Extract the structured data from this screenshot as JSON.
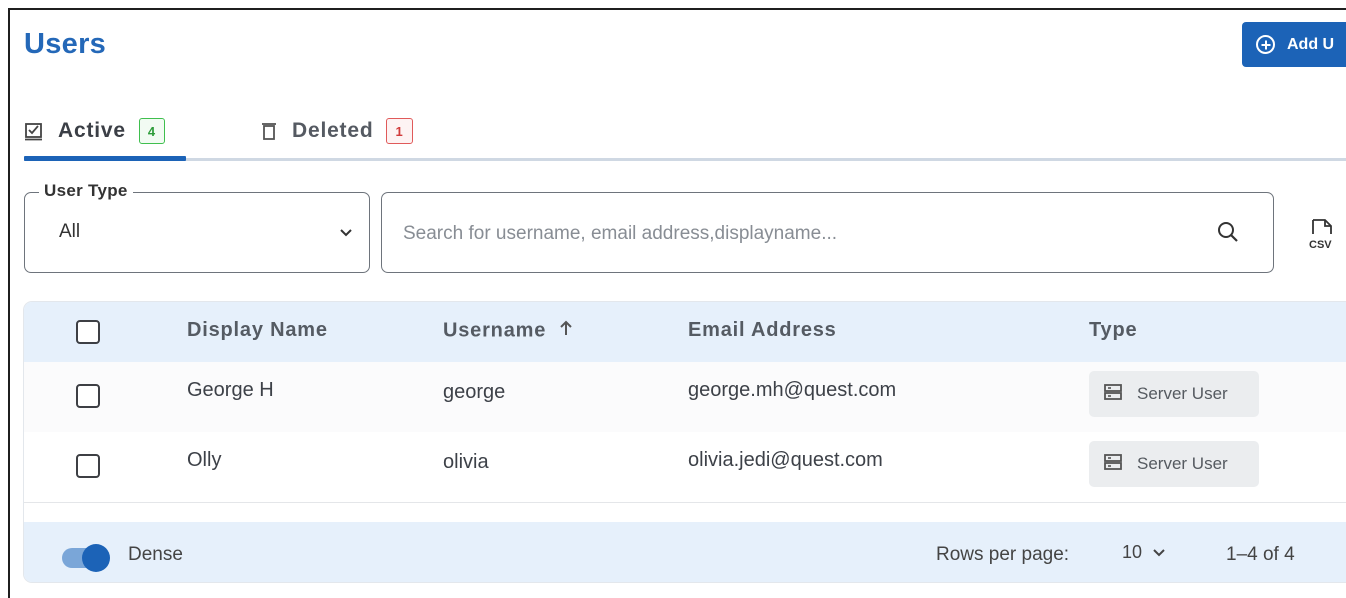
{
  "page": {
    "title": "Users"
  },
  "header": {
    "add_button_label": "Add U",
    "add_icon": "plus-circle-icon"
  },
  "tabs": [
    {
      "label": "Active",
      "count": "4",
      "icon": "checkbox-square-icon",
      "active": true
    },
    {
      "label": "Deleted",
      "count": "1",
      "icon": "trash-icon",
      "active": false
    }
  ],
  "filters": {
    "user_type_label": "User Type",
    "user_type_value": "All",
    "search_placeholder": "Search for username, email address,displayname...",
    "search_value": "",
    "export_icon": "csv-file-icon"
  },
  "table": {
    "columns": [
      "Display Name",
      "Username",
      "Email Address",
      "Type"
    ],
    "sort_icon": "arrow-up-icon",
    "rows": [
      {
        "display_name": "George H",
        "username": "george",
        "email": "george.mh@quest.com",
        "type": "Server User"
      },
      {
        "display_name": "Olly",
        "username": "olivia",
        "email": "olivia.jedi@quest.com",
        "type": "Server User"
      }
    ]
  },
  "footer": {
    "dense_label": "Dense",
    "dense_enabled": true,
    "rows_per_page_label": "Rows per page:",
    "rows_per_page_value": "10",
    "range": "1–4 of 4"
  },
  "colors": {
    "accent": "#1c63b7",
    "title": "#2468b8",
    "header_bg": "#e6f0fb",
    "active_badge": "#3fbf4e",
    "deleted_badge": "#e05a5a"
  }
}
